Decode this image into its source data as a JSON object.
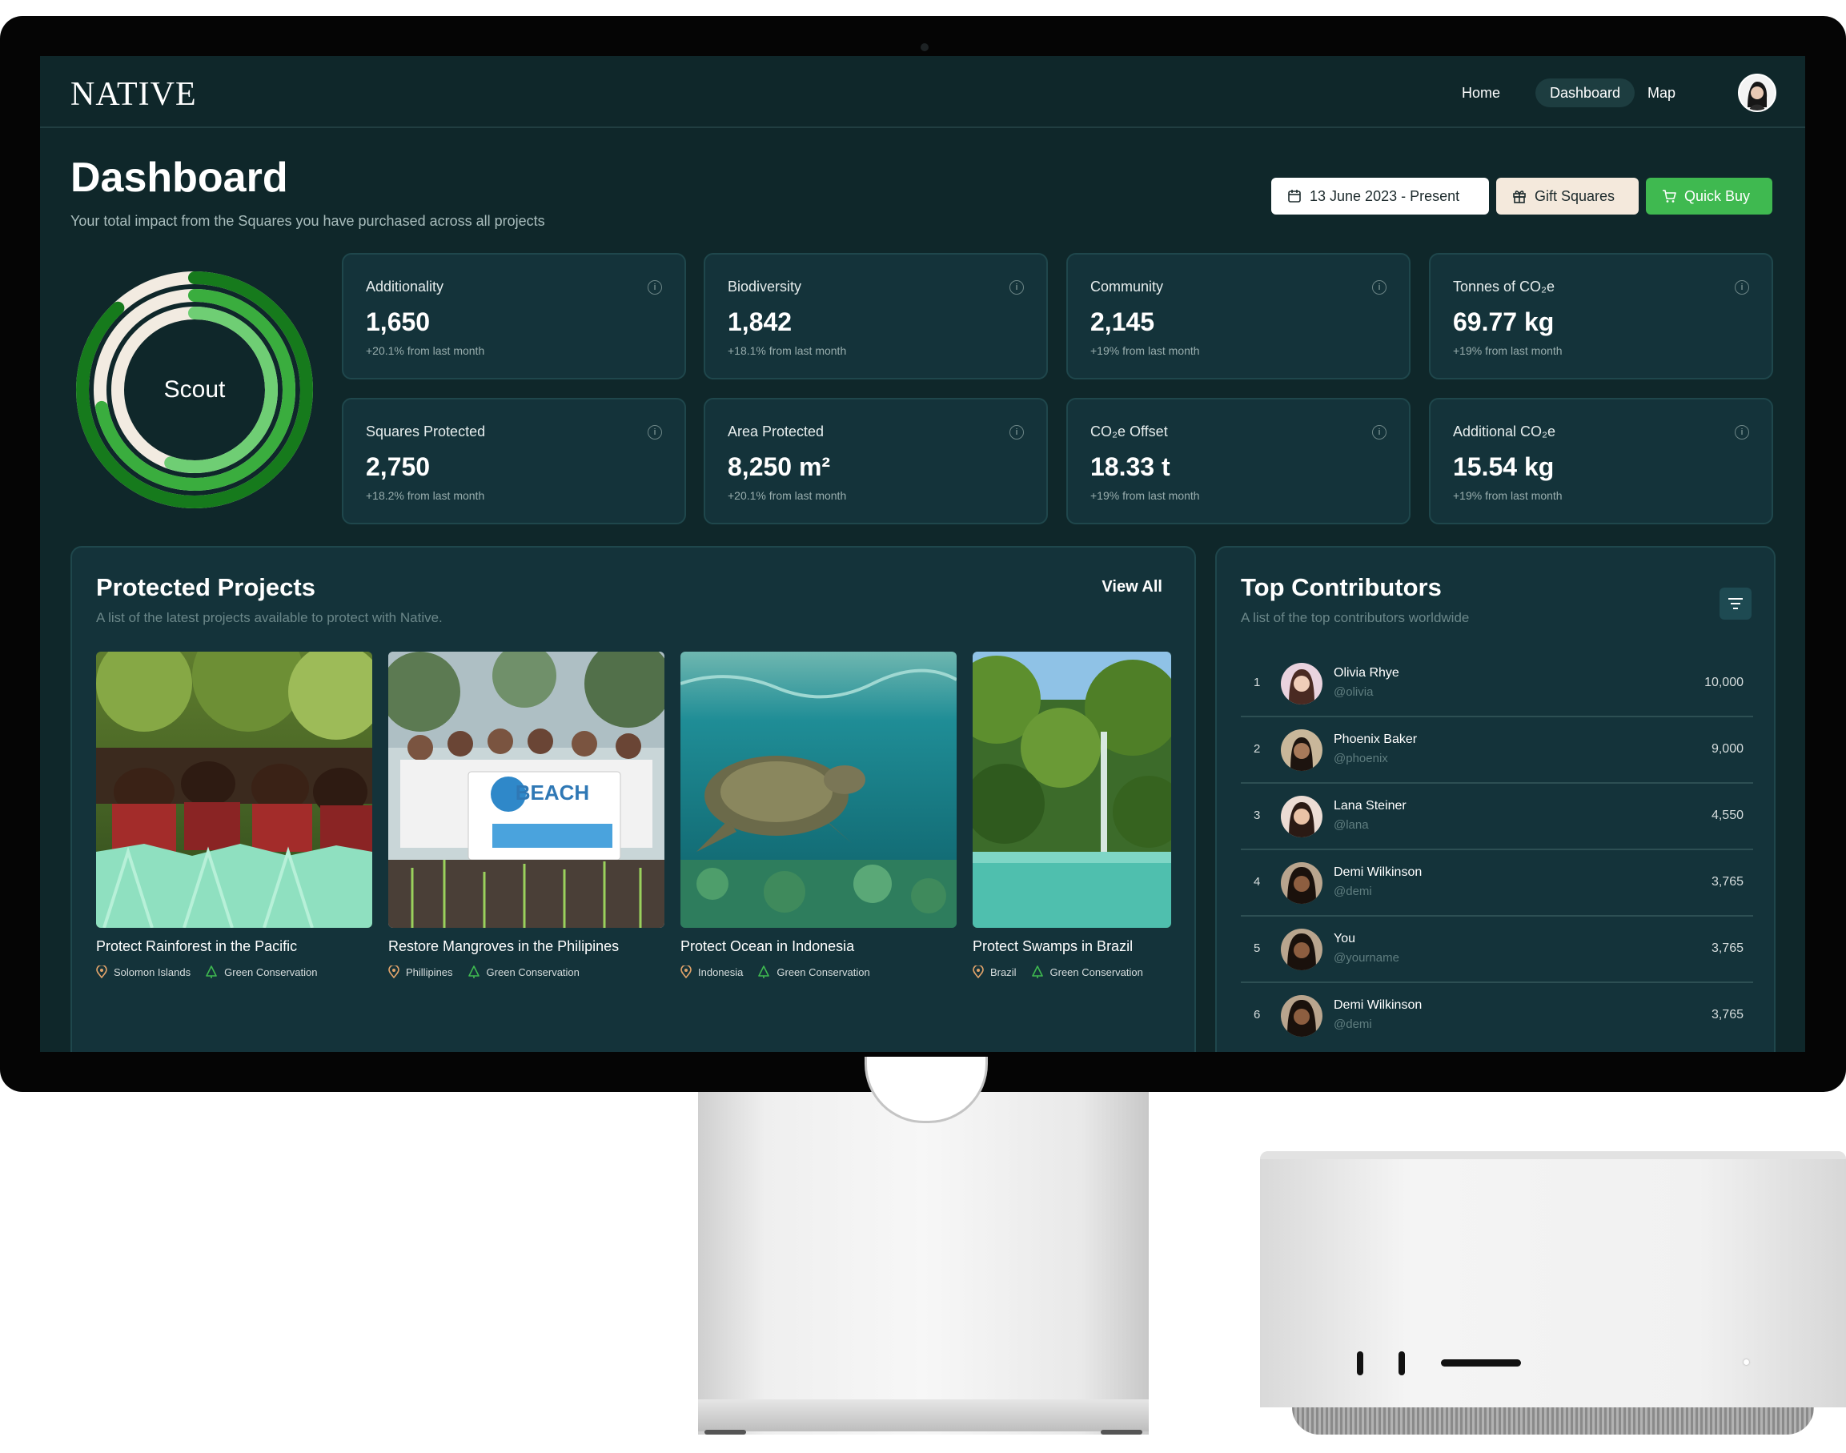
{
  "nav": {
    "logo": "NATIVE",
    "items": [
      {
        "label": "Home",
        "active": false
      },
      {
        "label": "Dashboard",
        "active": true
      },
      {
        "label": "Map",
        "active": false
      }
    ],
    "avatar_icon": "user-avatar-icon"
  },
  "header": {
    "title": "Dashboard",
    "subtitle": "Your total impact from the Squares you have purchased across all projects",
    "date_range": "13 June 2023 - Present",
    "gift_label": "Gift Squares",
    "buy_label": "Quick Buy"
  },
  "ring": {
    "label": "Scout",
    "levels": [
      0.88,
      0.72,
      0.55
    ],
    "colors": [
      "#167a1c",
      "#3aad3e",
      "#6fce74"
    ],
    "track": "#f2ebe1"
  },
  "stats": [
    {
      "label": "Additionality",
      "value": "1,650",
      "change": "+20.1% from last month"
    },
    {
      "label": "Biodiversity",
      "value": "1,842",
      "change": "+18.1% from last month"
    },
    {
      "label": "Community",
      "value": "2,145",
      "change": "+19% from last month"
    },
    {
      "label": "Tonnes of CO₂e",
      "value": "69.77 kg",
      "change": "+19% from last month"
    },
    {
      "label": "Squares Protected",
      "value": "2,750",
      "change": "+18.2% from last month"
    },
    {
      "label": "Area Protected",
      "value": "8,250 m²",
      "change": "+20.1% from last month"
    },
    {
      "label": "CO₂e Offset",
      "value": "18.33 t",
      "change": "+19% from last month"
    },
    {
      "label": "Additional CO₂e",
      "value": "15.54 kg",
      "change": "+19% from last month"
    }
  ],
  "projects_panel": {
    "title": "Protected Projects",
    "subtitle": "A list of the latest projects available to protect with Native.",
    "view_all": "View All",
    "projects": [
      {
        "title": "Protect Rainforest in the Pacific",
        "location": "Solomon Islands",
        "category": "Green Conservation"
      },
      {
        "title": "Restore Mangroves in the Philipines",
        "location": "Phillipines",
        "category": "Green Conservation",
        "banner_text": "BEACH"
      },
      {
        "title": "Protect Ocean in Indonesia",
        "location": "Indonesia",
        "category": "Green Conservation"
      },
      {
        "title": "Protect Swamps in Brazil",
        "location": "Brazil",
        "category": "Green Conservation"
      }
    ]
  },
  "contributors_panel": {
    "title": "Top Contributors",
    "subtitle": "A list of the top contributors worldwide",
    "contributors": [
      {
        "rank": "1",
        "name": "Olivia Rhye",
        "handle": "@olivia",
        "score": "10,000"
      },
      {
        "rank": "2",
        "name": "Phoenix Baker",
        "handle": "@phoenix",
        "score": "9,000"
      },
      {
        "rank": "3",
        "name": "Lana Steiner",
        "handle": "@lana",
        "score": "4,550"
      },
      {
        "rank": "4",
        "name": "Demi Wilkinson",
        "handle": "@demi",
        "score": "3,765"
      },
      {
        "rank": "5",
        "name": "You",
        "handle": "@yourname",
        "score": "3,765"
      },
      {
        "rank": "6",
        "name": "Demi Wilkinson",
        "handle": "@demi",
        "score": "3,765"
      }
    ]
  },
  "colors": {
    "background": "#0f272a",
    "card": "#14333a",
    "accent_green": "#3fb950",
    "gift_bg": "#f4e9dc"
  }
}
